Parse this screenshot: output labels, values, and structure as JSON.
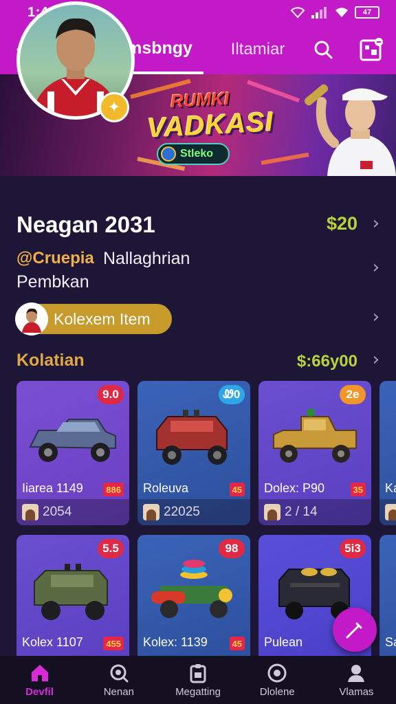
{
  "status_bar": {
    "time": "1:4:33",
    "battery": "47"
  },
  "app_bar": {
    "tab_active": "Vbstamsbngy",
    "tab_inactive": "Iltamiar"
  },
  "banner": {
    "title_line1": "RUMKI",
    "title_line2": "VADKASI",
    "pill_text": "Stleko"
  },
  "profile": {
    "name": "Neagan 2031",
    "price": "$20",
    "brand": "@Cruepia",
    "subtitle_1": "Nallaghrian",
    "subtitle_2": "Pembkan",
    "collection_button": "Kolexem Item"
  },
  "section": {
    "title": "Kolatian",
    "value": "$:66y00"
  },
  "cards": [
    {
      "name": "Iiarea 1149",
      "badge": "9.0",
      "tag": "886",
      "footer": "2054"
    },
    {
      "name": "Roleuva",
      "badge": "Ꮺ0",
      "tag": "45",
      "footer": "22025"
    },
    {
      "name": "Dolex: P90",
      "badge": "2e",
      "tag": "35",
      "footer": "2 / 14"
    },
    {
      "name": "Ka",
      "badge": "",
      "tag": "",
      "footer": ""
    },
    {
      "name": "Kolex 1107",
      "badge": "5.5",
      "tag": "455",
      "footer": ""
    },
    {
      "name": "Kolex: 1139",
      "badge": "98",
      "tag": "45",
      "footer": ""
    },
    {
      "name": "Pulean",
      "badge": "5i3",
      "tag": "",
      "footer": ""
    },
    {
      "name": "Sa",
      "badge": "",
      "tag": "",
      "footer": ""
    }
  ],
  "bottom_nav": [
    {
      "label": "Devfil",
      "icon": "home-icon",
      "active": true
    },
    {
      "label": "Nenan",
      "icon": "search-icon",
      "active": false
    },
    {
      "label": "Megatting",
      "icon": "clipboard-icon",
      "active": false
    },
    {
      "label": "Dlolene",
      "icon": "disc-icon",
      "active": false
    },
    {
      "label": "Vlamas",
      "icon": "profile-icon",
      "active": false
    }
  ],
  "colors": {
    "accent": "#c21ac6",
    "background": "#1d1636",
    "price_green": "#b7d43a",
    "gold": "#c79a2c"
  }
}
